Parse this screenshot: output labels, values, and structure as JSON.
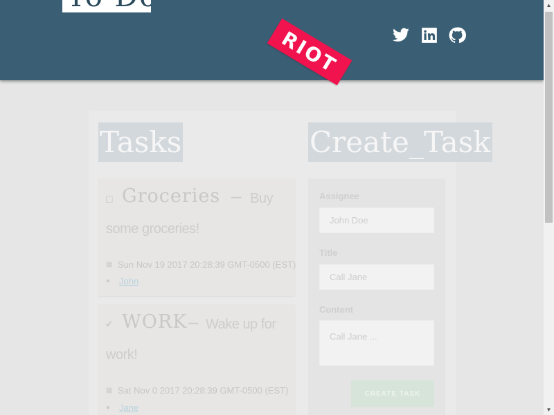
{
  "header": {
    "logo_text": "To Do",
    "badge": "RIOT",
    "social": [
      "twitter-icon",
      "linkedin-icon",
      "github-icon"
    ],
    "colors": {
      "header_bg": "#3a5f74",
      "badge_bg": "#f0134d"
    }
  },
  "tasks": {
    "title": "Tasks",
    "items": [
      {
        "name": "Groceries",
        "description_line1": "Buy",
        "description_line2": "some groceries!",
        "date": "Sun Nov 19 2017 20:28:39 GMT-0500 (EST)",
        "user": "John",
        "done": false
      },
      {
        "name": "WORK",
        "description_line1": "Wake up for",
        "description_line2": "work!",
        "date": "Sat Nov 0 2017 20:28:39 GMT-0500 (EST)",
        "user": "Jane",
        "done": true
      }
    ]
  },
  "create": {
    "title": "Create_Task",
    "assignee_label": "Assignee",
    "assignee_placeholder": "John Doe",
    "title_label": "Title",
    "title_placeholder": "Call Jane",
    "content_label": "Content",
    "content_placeholder": "Call Jane ...",
    "button": "CREATE TASK"
  }
}
